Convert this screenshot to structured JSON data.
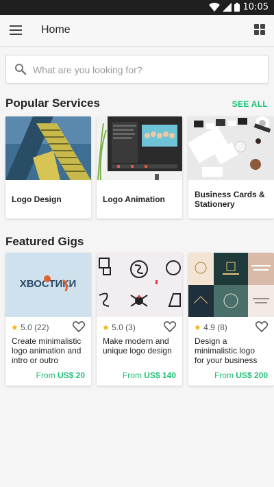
{
  "status_bar": {
    "time": "10:05"
  },
  "header": {
    "title": "Home"
  },
  "search": {
    "placeholder": "What are you looking for?"
  },
  "popular": {
    "title": "Popular Services",
    "see_all": "SEE ALL",
    "items": [
      {
        "label": "Logo Design"
      },
      {
        "label": "Logo Animation"
      },
      {
        "label": "Business Cards & Stationery"
      }
    ]
  },
  "featured": {
    "title": "Featured Gigs",
    "gigs": [
      {
        "logo_text": "ХВОСТИКИ",
        "rating": "5.0",
        "reviews": "(22)",
        "description": "Create minimalistic logo animation and intro or outro",
        "price_prefix": "From",
        "price": "US$ 20"
      },
      {
        "rating": "5.0",
        "reviews": "(3)",
        "description": "Make modern and unique logo design",
        "price_prefix": "From",
        "price": "US$ 140"
      },
      {
        "rating": "4.9",
        "reviews": "(8)",
        "description": "Design a minimalistic logo for your business",
        "price_prefix": "From",
        "price": "US$ 200"
      }
    ]
  },
  "colors": {
    "accent": "#1dbf73",
    "star": "#f0b400",
    "status_bar": "#1f1f1f"
  }
}
